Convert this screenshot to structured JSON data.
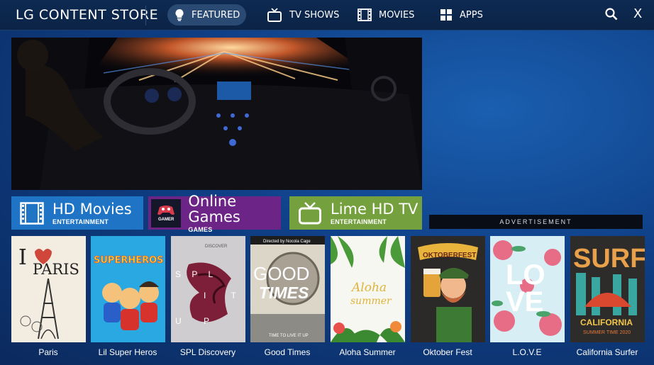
{
  "app": {
    "title": "LG CONTENT STORE"
  },
  "nav": {
    "items": [
      {
        "label": "FEATURED",
        "icon": "lightbulb-icon",
        "active": true
      },
      {
        "label": "TV SHOWS",
        "icon": "tv-icon"
      },
      {
        "label": "MOVIES",
        "icon": "film-icon"
      },
      {
        "label": "APPS",
        "icon": "apps-grid-icon"
      }
    ],
    "search_icon": "search-icon",
    "close_label": "X"
  },
  "categories": [
    {
      "title": "HD Movies",
      "subtitle": "ENTERTAINMENT",
      "icon": "film-icon",
      "color": "#1f74c5"
    },
    {
      "title": "Online Games",
      "subtitle": "GAMES",
      "icon": "gamepad-icon",
      "color": "#6c2487",
      "logo_text": "GAMER"
    },
    {
      "title": "Lime HD TV",
      "subtitle": "ENTERTAINMENT",
      "icon": "tv-icon",
      "color": "#74a03d"
    }
  ],
  "ad": {
    "label": "ADVERTISEMENT"
  },
  "posters": [
    {
      "label": "Paris",
      "art": [
        "I",
        "PARIS"
      ]
    },
    {
      "label": "Lil Super Heros",
      "art": [
        "SUPERHEROS"
      ]
    },
    {
      "label": "SPL Discovery",
      "art": [
        "DISCOVER",
        "S P L",
        "I T",
        "U P"
      ]
    },
    {
      "label": "Good Times",
      "art": [
        "Directed by Nocola Cage",
        "GOOD",
        "TIMES",
        "TIME TO LIVE IT UP"
      ]
    },
    {
      "label": "Aloha Summer",
      "art": [
        "Aloha",
        "summer"
      ]
    },
    {
      "label": "Oktober Fest",
      "art": [
        "OKTOBERFEST"
      ]
    },
    {
      "label": "L.O.V.E",
      "art": [
        "LO",
        "VE"
      ]
    },
    {
      "label": "California Surfer",
      "art": [
        "SURF",
        "CALIFORNIA",
        "SUMMER TIME 2020"
      ]
    }
  ],
  "colors": {
    "accent": "#1f74c5",
    "background": "#0f3f86"
  }
}
